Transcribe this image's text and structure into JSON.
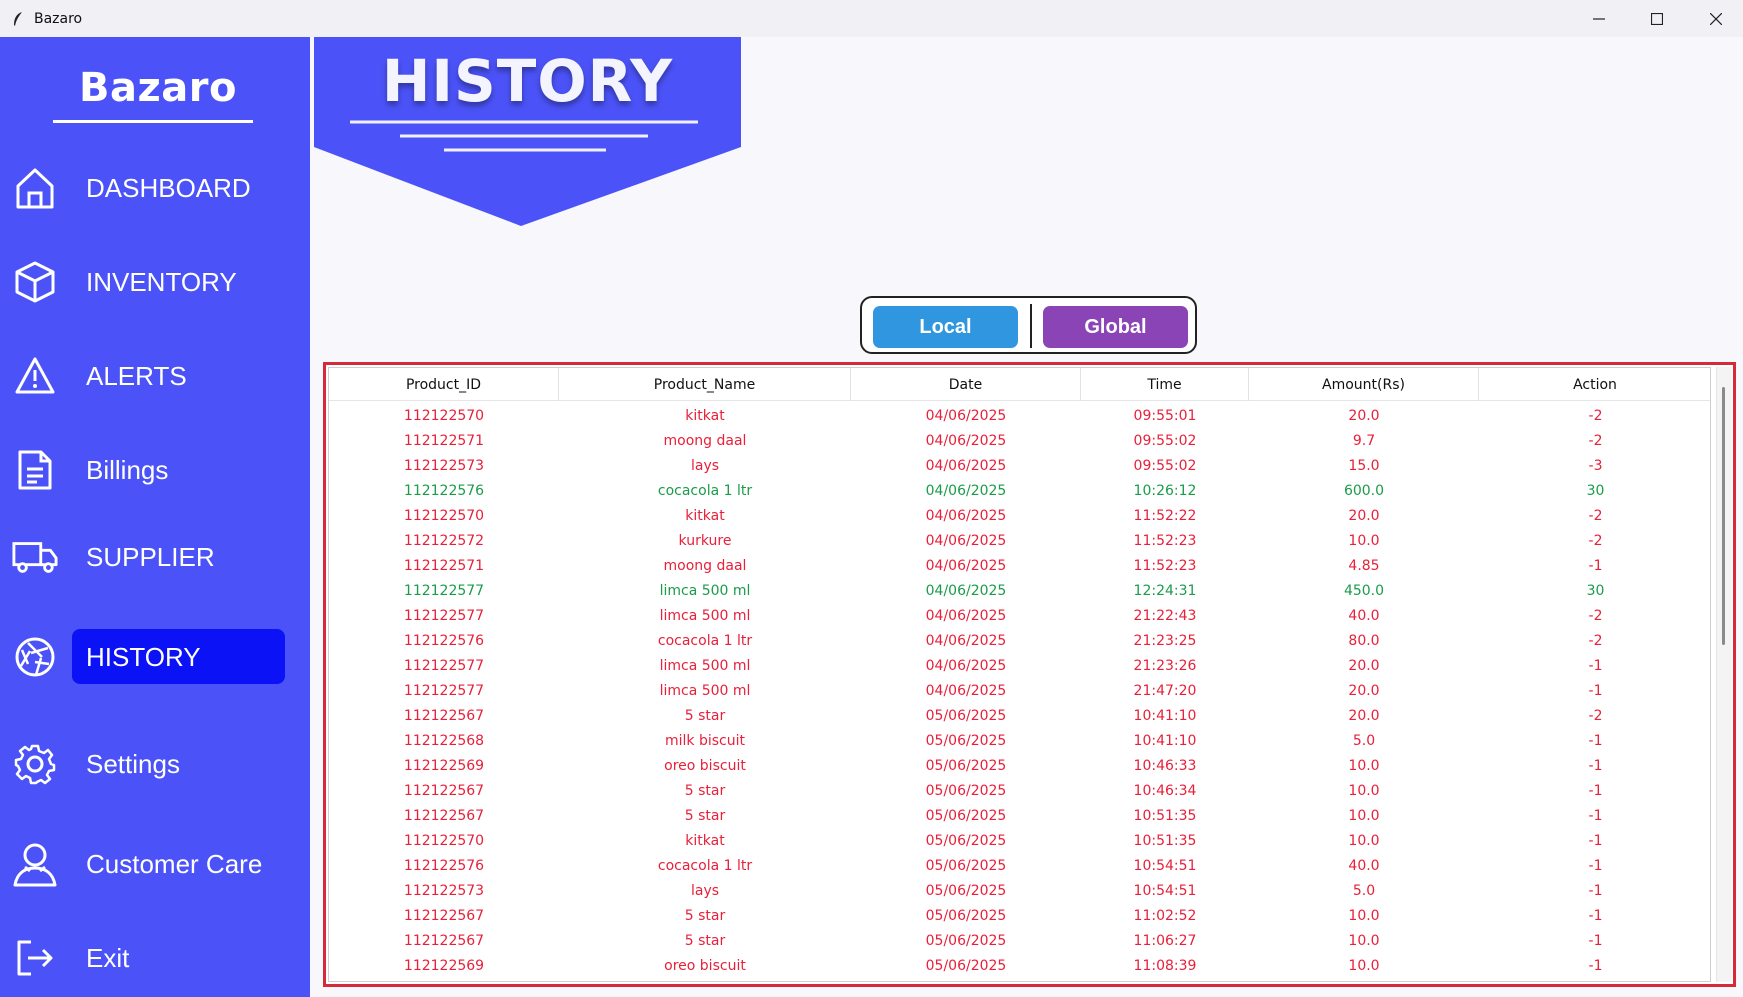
{
  "window": {
    "title": "Bazaro"
  },
  "sidebar": {
    "brand": "Bazaro",
    "items": [
      {
        "label": "DASHBOARD",
        "icon": "home-icon"
      },
      {
        "label": "INVENTORY",
        "icon": "box-icon"
      },
      {
        "label": "ALERTS",
        "icon": "warning-icon"
      },
      {
        "label": "Billings",
        "icon": "document-icon"
      },
      {
        "label": "SUPPLIER",
        "icon": "truck-icon"
      },
      {
        "label": "HISTORY",
        "icon": "aperture-icon",
        "active": true
      },
      {
        "label": "Settings",
        "icon": "gear-icon"
      },
      {
        "label": "Customer Care",
        "icon": "user-icon"
      },
      {
        "label": "Exit",
        "icon": "exit-icon"
      }
    ]
  },
  "header": {
    "title": "HISTORY"
  },
  "toggle": {
    "local_label": "Local",
    "global_label": "Global"
  },
  "colors": {
    "sidebar": "#4b53f8",
    "active_item": "#0b12f5",
    "local_button": "#2f96df",
    "global_button": "#8b44b6",
    "sale_row": "#e8203a",
    "restock_row": "#1a9c4a",
    "table_border": "#d42a3a"
  },
  "table": {
    "columns": [
      "Product_ID",
      "Product_Name",
      "Date",
      "Time",
      "Amount(Rs)",
      "Action"
    ],
    "rows": [
      {
        "cells": [
          "112122570",
          "kitkat",
          "04/06/2025",
          "09:55:01",
          "20.0",
          "-2"
        ],
        "type": "sale"
      },
      {
        "cells": [
          "112122571",
          "moong daal",
          "04/06/2025",
          "09:55:02",
          "9.7",
          "-2"
        ],
        "type": "sale"
      },
      {
        "cells": [
          "112122573",
          "lays",
          "04/06/2025",
          "09:55:02",
          "15.0",
          "-3"
        ],
        "type": "sale"
      },
      {
        "cells": [
          "112122576",
          "cocacola 1 ltr",
          "04/06/2025",
          "10:26:12",
          "600.0",
          "30"
        ],
        "type": "restock"
      },
      {
        "cells": [
          "112122570",
          "kitkat",
          "04/06/2025",
          "11:52:22",
          "20.0",
          "-2"
        ],
        "type": "sale"
      },
      {
        "cells": [
          "112122572",
          "kurkure",
          "04/06/2025",
          "11:52:23",
          "10.0",
          "-2"
        ],
        "type": "sale"
      },
      {
        "cells": [
          "112122571",
          "moong daal",
          "04/06/2025",
          "11:52:23",
          "4.85",
          "-1"
        ],
        "type": "sale"
      },
      {
        "cells": [
          "112122577",
          "limca 500 ml",
          "04/06/2025",
          "12:24:31",
          "450.0",
          "30"
        ],
        "type": "restock"
      },
      {
        "cells": [
          "112122577",
          "limca 500 ml",
          "04/06/2025",
          "21:22:43",
          "40.0",
          "-2"
        ],
        "type": "sale"
      },
      {
        "cells": [
          "112122576",
          "cocacola 1 ltr",
          "04/06/2025",
          "21:23:25",
          "80.0",
          "-2"
        ],
        "type": "sale"
      },
      {
        "cells": [
          "112122577",
          "limca 500 ml",
          "04/06/2025",
          "21:23:26",
          "20.0",
          "-1"
        ],
        "type": "sale"
      },
      {
        "cells": [
          "112122577",
          "limca 500 ml",
          "04/06/2025",
          "21:47:20",
          "20.0",
          "-1"
        ],
        "type": "sale"
      },
      {
        "cells": [
          "112122567",
          "5 star",
          "05/06/2025",
          "10:41:10",
          "20.0",
          "-2"
        ],
        "type": "sale"
      },
      {
        "cells": [
          "112122568",
          "milk biscuit",
          "05/06/2025",
          "10:41:10",
          "5.0",
          "-1"
        ],
        "type": "sale"
      },
      {
        "cells": [
          "112122569",
          "oreo biscuit",
          "05/06/2025",
          "10:46:33",
          "10.0",
          "-1"
        ],
        "type": "sale"
      },
      {
        "cells": [
          "112122567",
          "5 star",
          "05/06/2025",
          "10:46:34",
          "10.0",
          "-1"
        ],
        "type": "sale"
      },
      {
        "cells": [
          "112122567",
          "5 star",
          "05/06/2025",
          "10:51:35",
          "10.0",
          "-1"
        ],
        "type": "sale"
      },
      {
        "cells": [
          "112122570",
          "kitkat",
          "05/06/2025",
          "10:51:35",
          "10.0",
          "-1"
        ],
        "type": "sale"
      },
      {
        "cells": [
          "112122576",
          "cocacola 1 ltr",
          "05/06/2025",
          "10:54:51",
          "40.0",
          "-1"
        ],
        "type": "sale"
      },
      {
        "cells": [
          "112122573",
          "lays",
          "05/06/2025",
          "10:54:51",
          "5.0",
          "-1"
        ],
        "type": "sale"
      },
      {
        "cells": [
          "112122567",
          "5 star",
          "05/06/2025",
          "11:02:52",
          "10.0",
          "-1"
        ],
        "type": "sale"
      },
      {
        "cells": [
          "112122567",
          "5 star",
          "05/06/2025",
          "11:06:27",
          "10.0",
          "-1"
        ],
        "type": "sale"
      },
      {
        "cells": [
          "112122569",
          "oreo biscuit",
          "05/06/2025",
          "11:08:39",
          "10.0",
          "-1"
        ],
        "type": "sale"
      }
    ]
  }
}
